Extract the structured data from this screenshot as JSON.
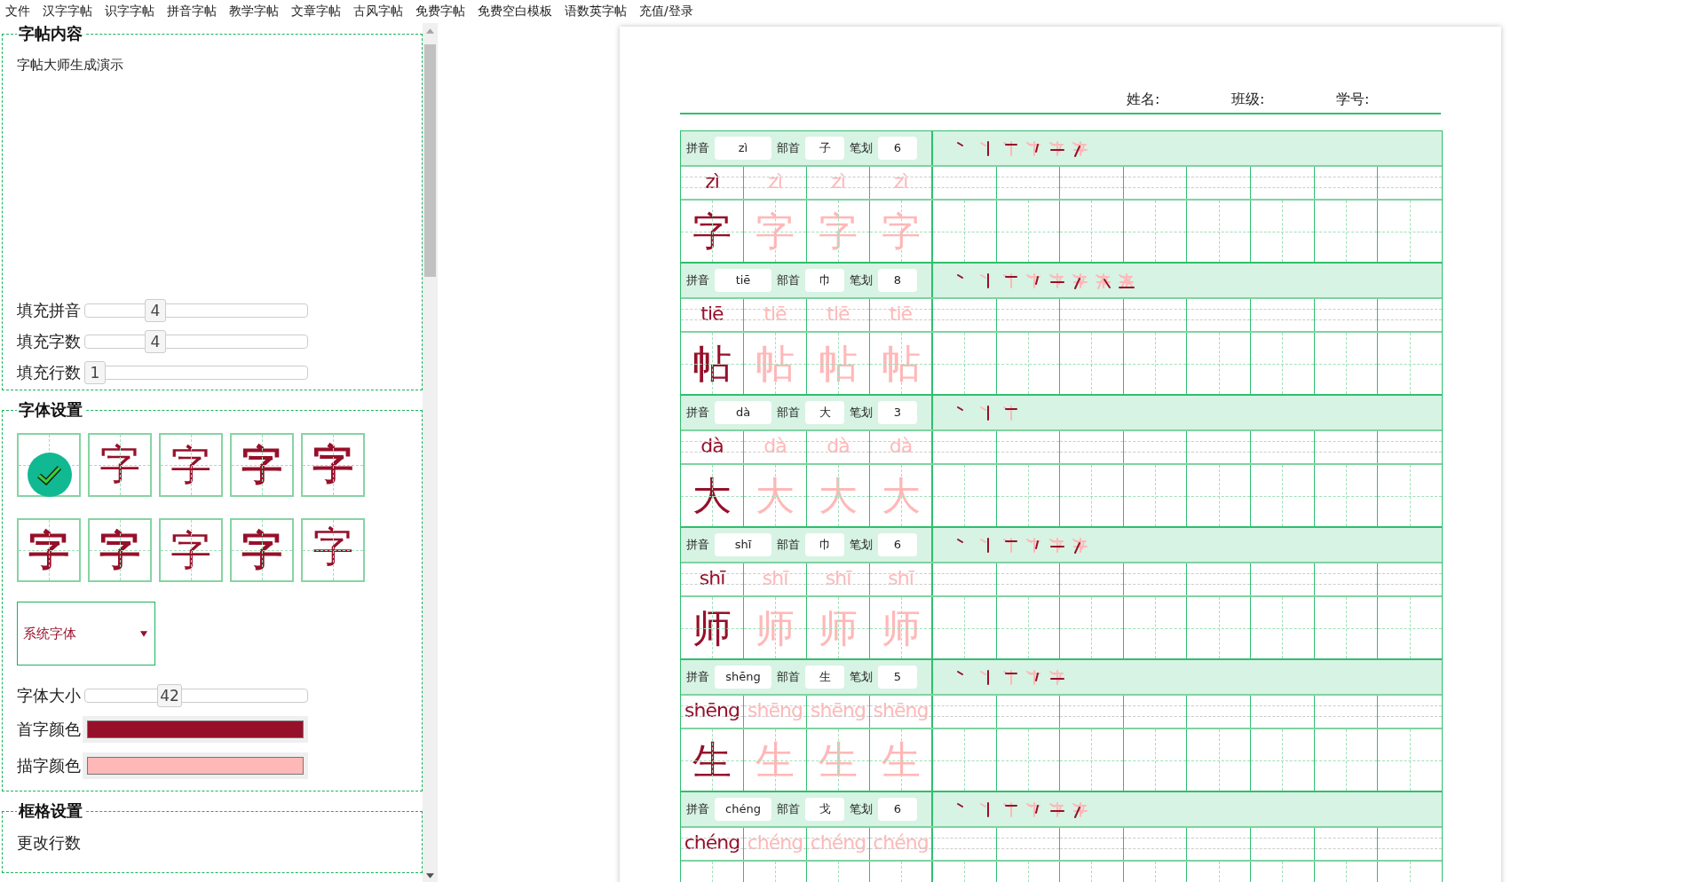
{
  "menu": [
    "文件",
    "汉字字帖",
    "识字字帖",
    "拼音字帖",
    "教学字帖",
    "文章字帖",
    "古风字帖",
    "免费字帖",
    "免费空白模板",
    "语数英字帖",
    "充值/登录"
  ],
  "content_panel": {
    "title": "字帖内容",
    "text": "字帖大师生成演示",
    "sliders": [
      {
        "label": "填充拼音",
        "value": "4",
        "level": 0.3
      },
      {
        "label": "填充字数",
        "value": "4",
        "level": 0.3
      },
      {
        "label": "填充行数",
        "value": "1",
        "level": 0.0
      }
    ]
  },
  "font_panel": {
    "title": "字体设置",
    "fonts": [
      {
        "selected": true
      },
      {
        "sample": "字",
        "selected": false
      },
      {
        "sample": "字",
        "selected": false
      },
      {
        "sample": "字",
        "selected": false
      },
      {
        "sample": "字",
        "selected": false
      },
      {
        "sample": "字",
        "selected": false
      },
      {
        "sample": "字",
        "selected": false
      },
      {
        "sample": "字",
        "selected": false
      },
      {
        "sample": "字",
        "selected": false
      },
      {
        "sample": "字",
        "selected": false
      }
    ],
    "select": {
      "value": "系统字体"
    },
    "size_slider": {
      "label": "字体大小",
      "value": "42",
      "level": 0.37
    },
    "colors": [
      {
        "label": "首字颜色",
        "color": "#96102a"
      },
      {
        "label": "描字颜色",
        "color": "#ffb8b8"
      }
    ]
  },
  "grid_panel": {
    "title": "框格设置",
    "rows_label": "更改行数"
  },
  "sheet": {
    "fields": [
      "姓名:",
      "班级:",
      "学号:"
    ],
    "blocks": [
      {
        "labels": [
          "拼音",
          "部首",
          "笔划"
        ],
        "pinyin": "zì",
        "radical": "子",
        "strokes": "6",
        "pinyin_cells": [
          "zì",
          "zì",
          "zì",
          "zì"
        ],
        "char_cells": [
          "字",
          "字",
          "字",
          "字"
        ]
      },
      {
        "labels": [
          "拼音",
          "部首",
          "笔划"
        ],
        "pinyin": "tiē",
        "radical": "巾",
        "strokes": "8",
        "pinyin_cells": [
          "tiē",
          "tiē",
          "tiē",
          "tiē"
        ],
        "char_cells": [
          "帖",
          "帖",
          "帖",
          "帖"
        ]
      },
      {
        "labels": [
          "拼音",
          "部首",
          "笔划"
        ],
        "pinyin": "dà",
        "radical": "大",
        "strokes": "3",
        "pinyin_cells": [
          "dà",
          "dà",
          "dà",
          "dà"
        ],
        "char_cells": [
          "大",
          "大",
          "大",
          "大"
        ]
      },
      {
        "labels": [
          "拼音",
          "部首",
          "笔划"
        ],
        "pinyin": "shī",
        "radical": "巾",
        "strokes": "6",
        "pinyin_cells": [
          "shī",
          "shī",
          "shī",
          "shī"
        ],
        "char_cells": [
          "师",
          "师",
          "师",
          "师"
        ]
      },
      {
        "labels": [
          "拼音",
          "部首",
          "笔划"
        ],
        "pinyin": "shēng",
        "radical": "生",
        "strokes": "5",
        "pinyin_cells": [
          "shēng",
          "shēng",
          "shēng",
          "shēng"
        ],
        "char_cells": [
          "生",
          "生",
          "生",
          "生"
        ]
      },
      {
        "labels": [
          "拼音",
          "部首",
          "笔划"
        ],
        "pinyin": "chéng",
        "radical": "戈",
        "strokes": "6",
        "pinyin_cells": [
          "chéng",
          "chéng",
          "chéng",
          "chéng"
        ]
      }
    ]
  }
}
